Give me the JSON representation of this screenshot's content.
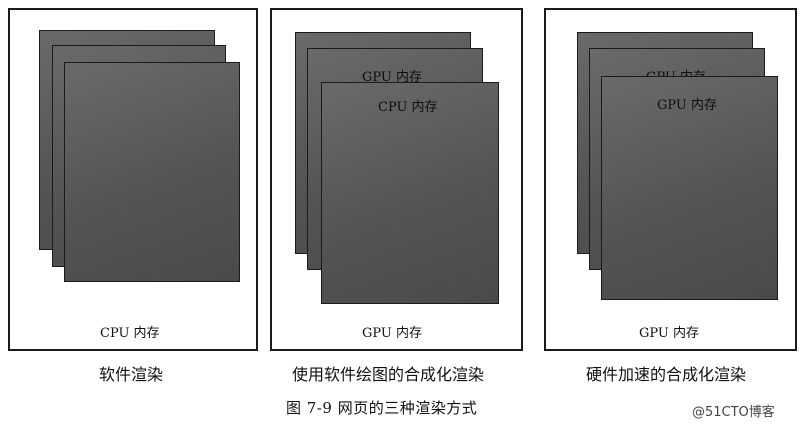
{
  "panels": [
    {
      "memory_label": "CPU 内存",
      "layer_labels": [
        "",
        "",
        ""
      ],
      "caption": "软件渲染"
    },
    {
      "memory_label": "GPU 内存",
      "layer_labels": [
        "",
        "GPU 内存",
        "CPU 内存"
      ],
      "caption": "使用软件绘图的合成化渲染"
    },
    {
      "memory_label": "GPU 内存",
      "layer_labels": [
        "",
        "GPU 内存",
        "GPU 内存"
      ],
      "caption": "硬件加速的合成化渲染"
    }
  ],
  "figure_caption": "图 7-9    网页的三种渲染方式",
  "watermark": "@51CTO博客"
}
